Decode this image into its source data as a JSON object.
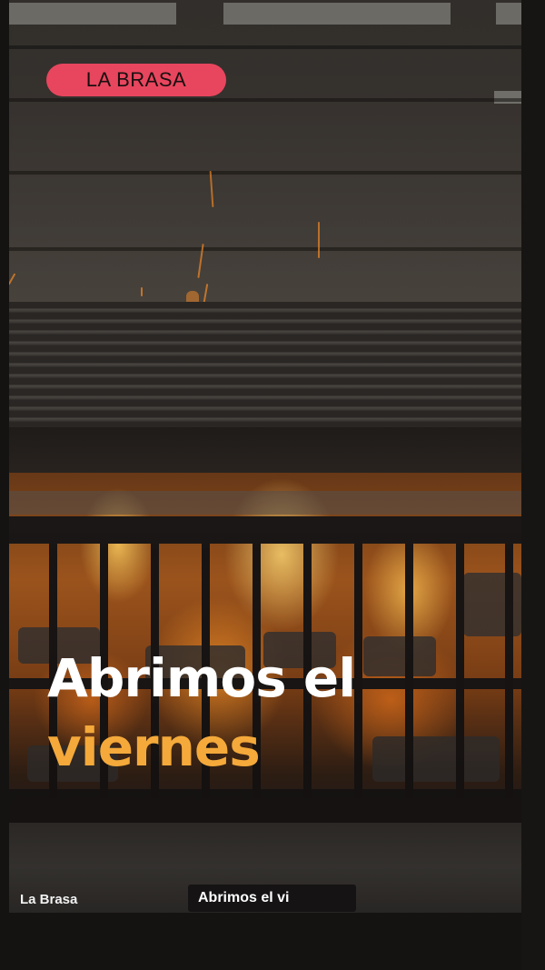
{
  "badge": {
    "label": "LA BRASA",
    "color": "#e8465e"
  },
  "headline": {
    "line1": "Abrimos el",
    "line2": "viernes",
    "line1_color": "#ffffff",
    "line2_color": "#f4a93a"
  },
  "footer": {
    "brand": "La Brasa",
    "caption": "Abrimos el vi"
  },
  "background": {
    "scene": "charcoal grill fire"
  }
}
